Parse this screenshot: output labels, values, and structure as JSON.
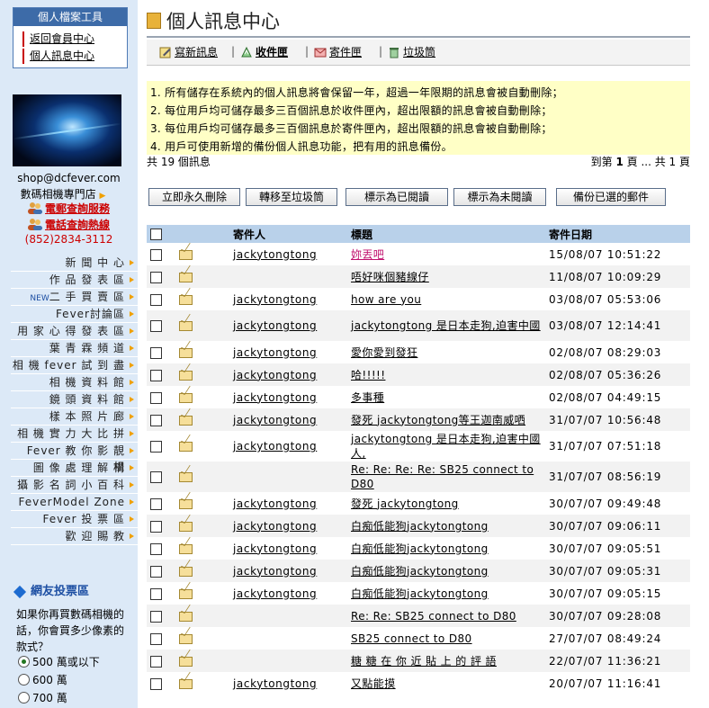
{
  "sidebar": {
    "tools_title": "個人檔案工具",
    "tools_links": [
      "返回會員中心",
      "個人訊息中心"
    ],
    "shop_email": "shop@dcfever.com",
    "shop_name": "數碼相機專門店",
    "service_email": "電郵查詢服務",
    "service_phone": "電話查詢熱線",
    "phone": "(852)2834-3112",
    "nav": [
      {
        "label": "新 聞 中 心"
      },
      {
        "label": "作 品 發 表 區"
      },
      {
        "label": "二 手 買 賣 區",
        "tag": "NEW"
      },
      {
        "label": "Fever討論區"
      },
      {
        "label": "用 家 心 得 發 表 區"
      },
      {
        "label": "葉 青 霖 頻 道"
      },
      {
        "label": "相 機 fever 試 到 盡"
      },
      {
        "label": "相 機 資 料 館"
      },
      {
        "label": "鏡 頭 資 料 館"
      },
      {
        "label": "樣 本 照 片 廊"
      },
      {
        "label": "相 機 實 力 大 比 拼"
      },
      {
        "label": "Fever 教 你 影 靚 相"
      },
      {
        "label": "圖 像 處 理 解 構"
      },
      {
        "label": "攝 影 名 詞 小 百 科"
      },
      {
        "label": "FeverModel Zone"
      },
      {
        "label": "Fever 投 票 區"
      },
      {
        "label": "歡 迎 賜 教"
      }
    ],
    "vote": {
      "title": "網友投票區",
      "question": "如果你再買數碼相機的話，你會買多少像素的款式？",
      "options": [
        "500 萬或以下",
        "600 萬",
        "700 萬"
      ],
      "selected": 0
    }
  },
  "main": {
    "title": "個人訊息中心",
    "tabs": [
      {
        "label": "寫新訊息",
        "icon": "compose-icon"
      },
      {
        "label": "收件匣",
        "icon": "inbox-icon",
        "active": true
      },
      {
        "label": "寄件匣",
        "icon": "outbox-icon"
      },
      {
        "label": "垃圾筒",
        "icon": "trash-icon"
      }
    ],
    "notices": [
      "1. 所有儲存在系統內的個人訊息將會保留一年，超過一年限期的訊息會被自動刪除；",
      "2. 每位用戶均可儲存最多三百個訊息於收件匣內，超出限額的訊息會被自動刪除；",
      "3. 每位用戶均可儲存最多三百個訊息於寄件匣內，超出限額的訊息會被自動刪除；",
      "4. 用戶可使用新增的備份個人訊息功能，把有用的訊息備份。"
    ],
    "count_text": "共 19 個訊息",
    "pager": {
      "prefix": "到第",
      "page": "1",
      "suffix": "頁 ... 共 1 頁"
    },
    "actions": [
      "立即永久刪除",
      "轉移至垃圾筒",
      "標示為已閱讀",
      "標示為未閱讀",
      "備份已選的郵件"
    ],
    "table": {
      "headers": {
        "sender": "寄件人",
        "subject": "標題",
        "date": "寄件日期"
      },
      "rows": [
        {
          "sender": "jackytongtong",
          "subject": "妳丟吧",
          "date": "15/08/07 10:51:22",
          "visited": true
        },
        {
          "sender": "",
          "subject": "唔好咪個豬線仔",
          "date": "11/08/07 10:09:29"
        },
        {
          "sender": "jackytongtong",
          "subject": "how are you",
          "date": "03/08/07 05:53:06"
        },
        {
          "sender": "jackytongtong",
          "subject": "jackytongtong 是日本走狗,迫害中國",
          "date": "03/08/07 12:14:41",
          "tall": true
        },
        {
          "sender": "jackytongtong",
          "subject": "愛你愛到發狂",
          "date": "02/08/07 08:29:03"
        },
        {
          "sender": "jackytongtong",
          "subject": "哈!!!!!",
          "date": "02/08/07 05:36:26"
        },
        {
          "sender": "jackytongtong",
          "subject": "多事種",
          "date": "02/08/07 04:49:15"
        },
        {
          "sender": "jackytongtong",
          "subject": "發死 jackytongtong等王迦南威哂",
          "date": "31/07/07 10:56:48"
        },
        {
          "sender": "jackytongtong",
          "subject": "jackytongtong 是日本走狗,迫害中國人,",
          "date": "31/07/07 07:51:18",
          "tall": true
        },
        {
          "sender": "",
          "subject": "Re: Re: Re: Re: SB25 connect to D80",
          "date": "31/07/07 08:56:19",
          "tall": true
        },
        {
          "sender": "jackytongtong",
          "subject": "發死 jackytongtong",
          "date": "30/07/07 09:49:48"
        },
        {
          "sender": "jackytongtong",
          "subject": "白痴低能狗jackytongtong",
          "date": "30/07/07 09:06:11"
        },
        {
          "sender": "jackytongtong",
          "subject": "白痴低能狗jackytongtong",
          "date": "30/07/07 09:05:51"
        },
        {
          "sender": "jackytongtong",
          "subject": "白痴低能狗jackytongtong",
          "date": "30/07/07 09:05:31"
        },
        {
          "sender": "jackytongtong",
          "subject": "白痴低能狗jackytongtong",
          "date": "30/07/07 09:05:15"
        },
        {
          "sender": "",
          "subject": "Re: Re: SB25 connect to D80",
          "date": "30/07/07 09:28:08"
        },
        {
          "sender": "",
          "subject": "SB25 connect to D80",
          "date": "27/07/07 08:49:24"
        },
        {
          "sender": "",
          "subject": "糖 糖 在 你 近 貼 上 的 評 語",
          "date": "22/07/07 11:36:21"
        },
        {
          "sender": "jackytongtong",
          "subject": "又點能摸",
          "date": "20/07/07 11:16:41"
        }
      ]
    }
  }
}
